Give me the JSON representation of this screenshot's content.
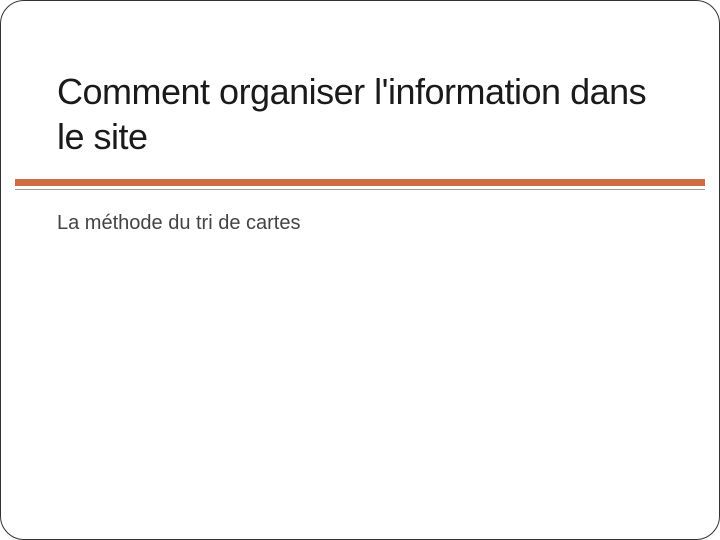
{
  "slide": {
    "title": "Comment organiser l'information dans le site",
    "subtitle": "La méthode du tri de cartes"
  },
  "colors": {
    "accent": "#ce6b42"
  }
}
